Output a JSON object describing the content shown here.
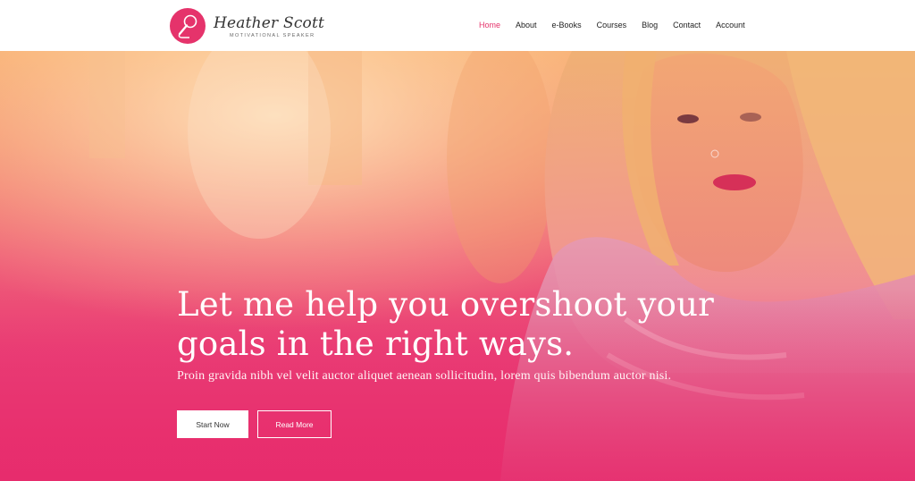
{
  "brand": {
    "name": "Heather Scott",
    "tagline": "MOTIVATIONAL SPEAKER",
    "accent_color": "#e5336b",
    "logo_icon": "microphone-icon"
  },
  "nav": {
    "items": [
      {
        "label": "Home",
        "active": true
      },
      {
        "label": "About",
        "active": false
      },
      {
        "label": "e-Books",
        "active": false
      },
      {
        "label": "Courses",
        "active": false
      },
      {
        "label": "Blog",
        "active": false
      },
      {
        "label": "Contact",
        "active": false
      },
      {
        "label": "Account",
        "active": false
      }
    ]
  },
  "hero": {
    "headline_line1": "Let me help you overshoot your",
    "headline_line2": "goals in the right ways.",
    "subtext": "Proin gravida nibh vel velit auctor aliquet aenean sollicitudin, lorem quis bibendum auctor nisi.",
    "primary_button": "Start Now",
    "secondary_button": "Read More",
    "gradient_top": "#f7a96b",
    "gradient_bottom": "#e72c6d"
  }
}
